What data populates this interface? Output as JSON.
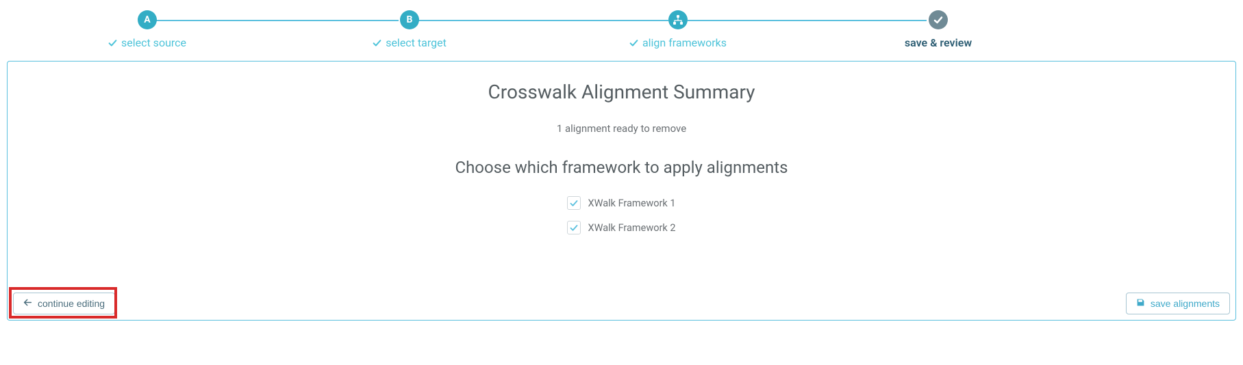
{
  "stepper": {
    "steps": [
      {
        "badge": "A",
        "label": "select source"
      },
      {
        "badge": "B",
        "label": "select target"
      },
      {
        "badge": "icon",
        "label": "align frameworks"
      },
      {
        "badge": "check",
        "label": "save & review"
      }
    ]
  },
  "panel": {
    "title": "Crosswalk Alignment Summary",
    "subtext": "1 alignment ready to remove",
    "subtitle": "Choose which framework to apply alignments",
    "frameworks": [
      {
        "label": "XWalk Framework 1"
      },
      {
        "label": "XWalk Framework 2"
      }
    ],
    "back_label": "continue editing",
    "save_label": "save alignments"
  }
}
